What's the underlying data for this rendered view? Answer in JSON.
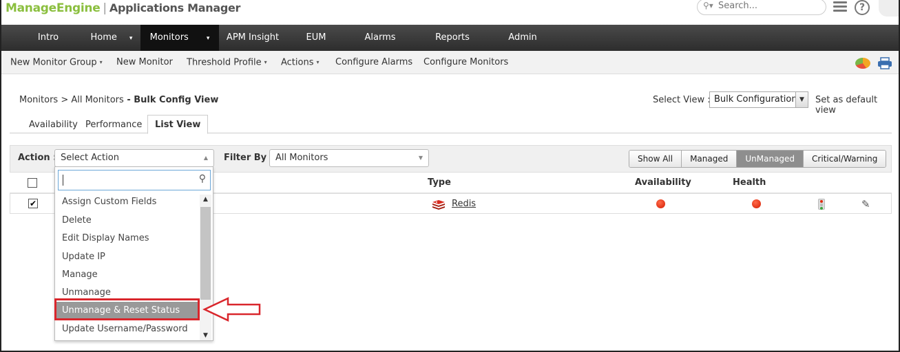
{
  "header": {
    "logo_part1": "Manage",
    "logo_part2": "Engine",
    "logo_sep": "|",
    "app_title": "Applications Manager",
    "search_placeholder": "Search...",
    "help_label": "?"
  },
  "nav": {
    "items": [
      {
        "label": "Intro"
      },
      {
        "label": "Home"
      },
      {
        "label": "Monitors"
      },
      {
        "label": "APM Insight"
      },
      {
        "label": "EUM"
      },
      {
        "label": "Alarms"
      },
      {
        "label": "Reports"
      },
      {
        "label": "Admin"
      }
    ],
    "caret": "▾",
    "active": "Monitors"
  },
  "subbar": {
    "items": [
      {
        "label": "New Monitor Group",
        "caret": "▾"
      },
      {
        "label": "New Monitor",
        "caret": ""
      },
      {
        "label": "Threshold Profile",
        "caret": "▾"
      },
      {
        "label": "Actions",
        "caret": "▾"
      },
      {
        "label": "Configure Alarms",
        "caret": ""
      },
      {
        "label": "Configure Monitors",
        "caret": ""
      }
    ]
  },
  "breadcrumb": {
    "path": "Monitors > All Monitors",
    "current": " - Bulk Config View"
  },
  "view": {
    "label": "Select View :",
    "selected": "Bulk Configuration",
    "set_default": "Set as default view"
  },
  "tabs": [
    {
      "label": "Availability"
    },
    {
      "label": "Performance"
    },
    {
      "label": "List View",
      "active": true
    }
  ],
  "actionbar": {
    "action_label": "Action :",
    "action_value": "Select Action",
    "filter_label": "Filter By :",
    "filter_value": "All Monitors",
    "buttons": [
      {
        "label": "Show All"
      },
      {
        "label": "Managed"
      },
      {
        "label": "UnManaged",
        "active": true
      },
      {
        "label": "Critical/Warning"
      }
    ]
  },
  "table": {
    "headers": {
      "type": "Type",
      "availability": "Availability",
      "health": "Health"
    },
    "rows": [
      {
        "checked": "✔",
        "type": "Redis",
        "availability_status": "critical",
        "health_status": "critical"
      }
    ],
    "status_color": "#e02b10"
  },
  "action_dropdown": {
    "search_value": "",
    "options": [
      {
        "label": "Assign Custom Fields"
      },
      {
        "label": "Delete"
      },
      {
        "label": "Edit Display Names"
      },
      {
        "label": "Update IP"
      },
      {
        "label": "Manage"
      },
      {
        "label": "Unmanage"
      },
      {
        "label": "Unmanage & Reset Status",
        "selected": true
      },
      {
        "label": "Update Username/Password"
      }
    ],
    "highlight_color": "#d9262c"
  }
}
